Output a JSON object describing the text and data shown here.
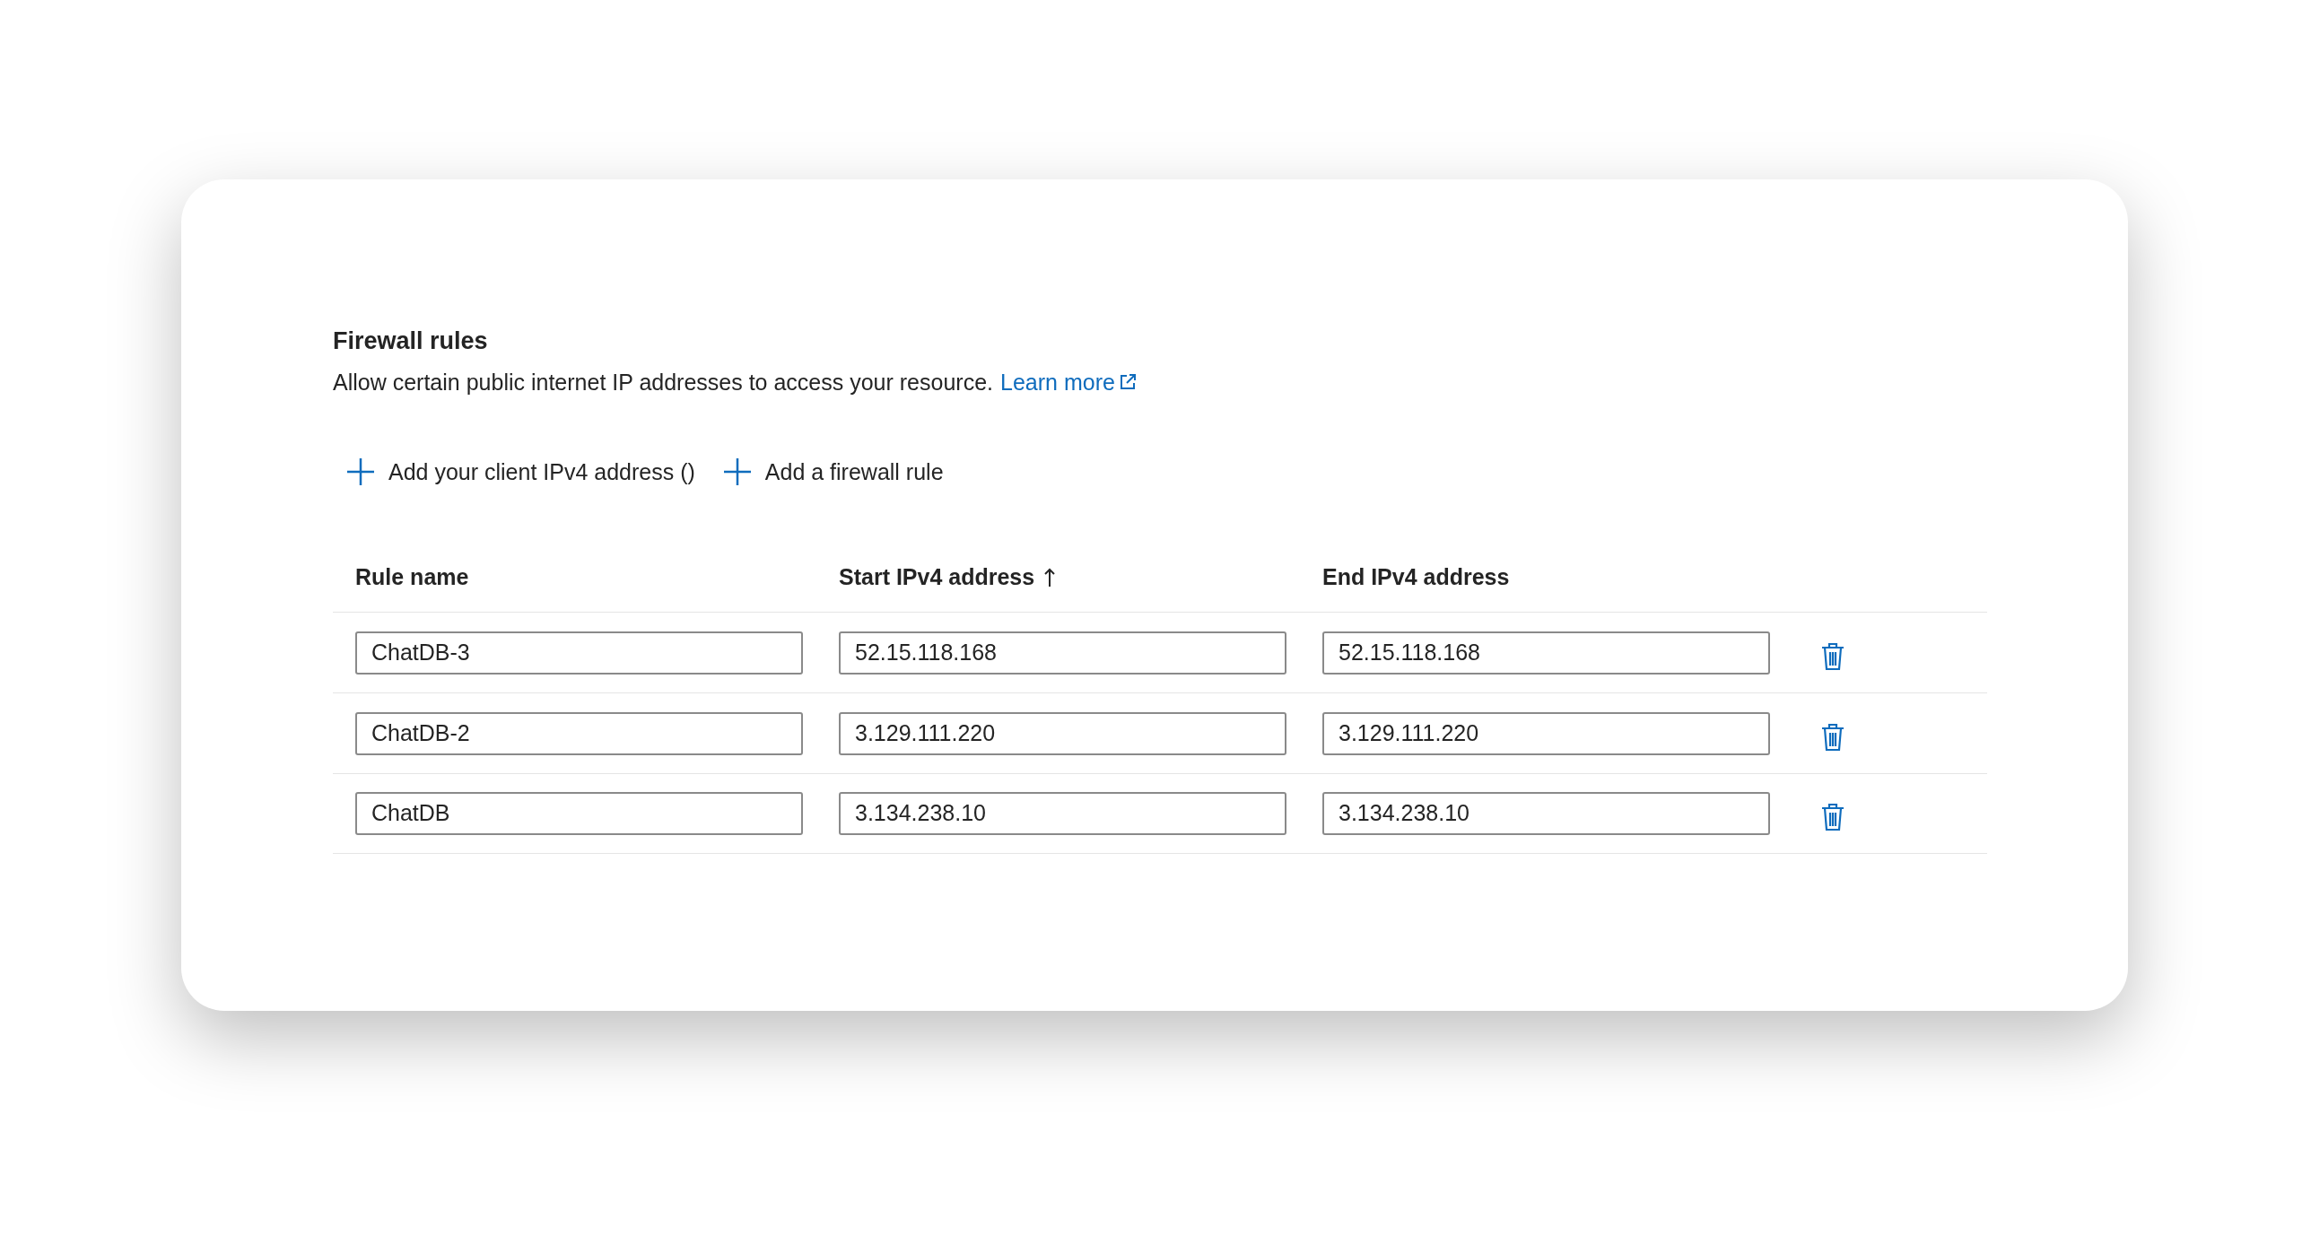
{
  "section": {
    "title": "Firewall rules",
    "description": "Allow certain public internet IP addresses to access your resource.",
    "link": "Learn more"
  },
  "actions": [
    {
      "label": "Add your client IPv4 address ()"
    },
    {
      "label": "Add a firewall rule"
    }
  ],
  "table": {
    "columns": [
      {
        "label": "Rule name",
        "sorted": false
      },
      {
        "label": "Start IPv4 address",
        "sorted": true
      },
      {
        "label": "End IPv4 address",
        "sorted": false
      }
    ],
    "rows": [
      {
        "name": "ChatDB-3",
        "start": "52.15.118.168",
        "end": "52.15.118.168"
      },
      {
        "name": "ChatDB-2",
        "start": "3.129.111.220",
        "end": "3.129.111.220"
      },
      {
        "name": "ChatDB",
        "start": "3.134.238.10",
        "end": "3.134.238.10"
      }
    ]
  }
}
